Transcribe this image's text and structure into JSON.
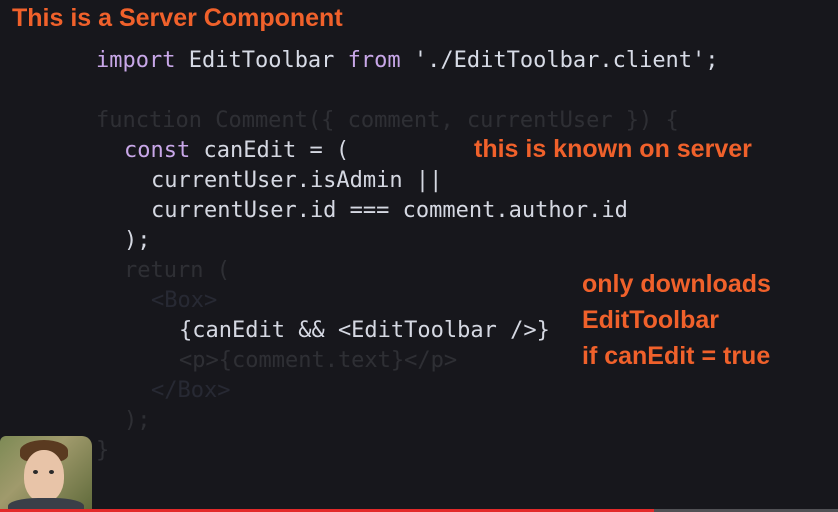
{
  "annotations": {
    "title": "This is a Server Component",
    "server": "this is known on server",
    "download_line1": "only downloads",
    "download_line2": "EditToolbar",
    "download_line3": "if canEdit = true"
  },
  "code": {
    "import_kw": "import",
    "import_name": " EditToolbar ",
    "from_kw": "from",
    "import_path": " './EditToolbar.client';",
    "function_line": "function Comment({ comment, currentUser }) {",
    "const_kw": "const",
    "const_rest": " canEdit = (",
    "line_admin": "currentUser.isAdmin ||",
    "line_id": "currentUser.id === comment.author.id",
    "line_close": ");",
    "return_line": "return (",
    "box_open": "<Box>",
    "jsx_line": "{canEdit && <EditToolbar />}",
    "p_line": "<p>{comment.text}</p>",
    "box_close": "</Box>",
    "paren_close": ");",
    "brace_close": "}"
  },
  "video": {
    "progress_fraction": 0.78
  },
  "colors": {
    "annotation": "#f0612b",
    "progress": "#e32a2a",
    "background": "#17171c"
  }
}
